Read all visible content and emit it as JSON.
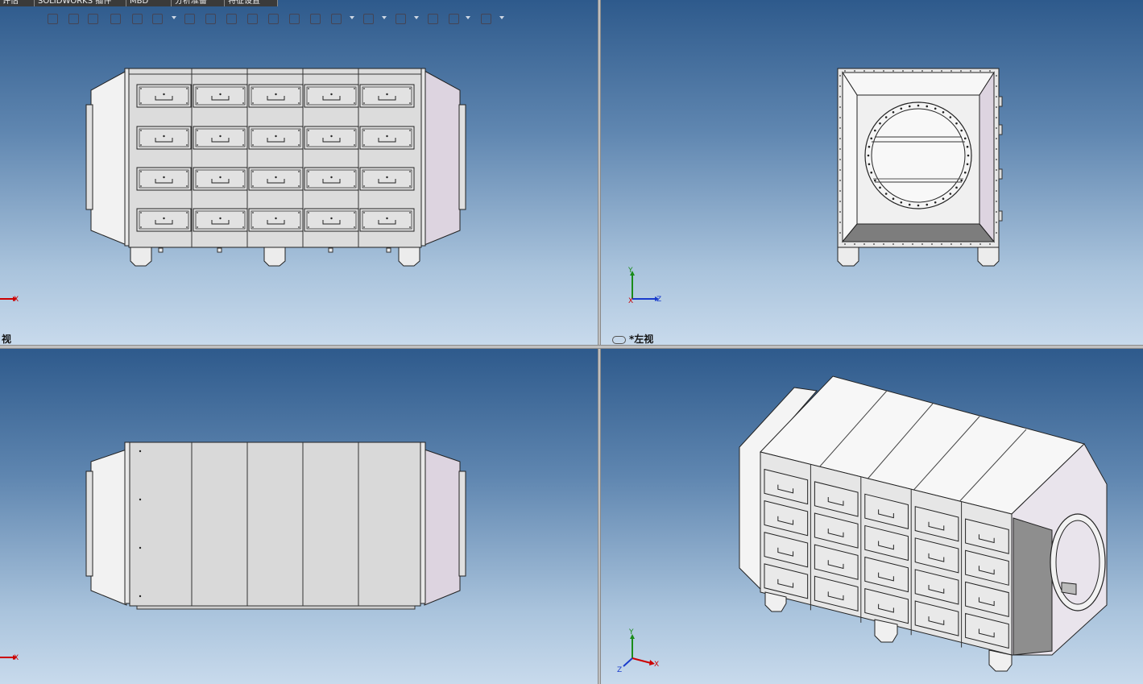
{
  "tabs": [
    "评估",
    "SOLIDWORKS 插件",
    "MBD",
    "分析准备",
    "特征设置"
  ],
  "viewports": {
    "top_left": {
      "label": "视"
    },
    "top_right": {
      "label": "*左视"
    },
    "bottom_left": {
      "label": ""
    },
    "bottom_right": {
      "label": ""
    }
  },
  "axes": {
    "x": "X",
    "y": "Y",
    "z": "Z"
  },
  "toolbar_icons": [
    "view-orientation-icon",
    "section-view-icon",
    "zoom-fit-icon",
    "previous-view-icon",
    "view-cube-icon",
    "display-style-icon",
    "hide-show-icon",
    "rotate-view-icon",
    "zoom-area-icon",
    "zoom-in-out-icon",
    "pan-icon",
    "3d-drawing-icon",
    "sketch-icon",
    "edit-appearance-icon",
    "apply-scene-icon",
    "view-settings-icon",
    "hide-items-icon",
    "render-tools-icon",
    "appearance-palette-icon",
    "display-monitor-icon"
  ],
  "colors": {
    "viewport_top": "#2e5a8c",
    "viewport_bottom": "#c8daec",
    "panel_fill": "#d9d9d9",
    "panel_highlight": "#f2f2f2",
    "hood_purple": "#ddd4e0",
    "axis_x": "#cc0000",
    "axis_y": "#1a8c1a",
    "axis_z": "#1a3ccc"
  }
}
